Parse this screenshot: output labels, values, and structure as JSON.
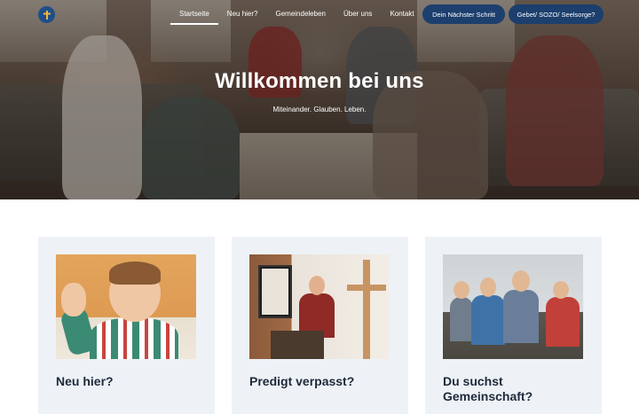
{
  "nav": {
    "items": [
      {
        "label": "Startseite",
        "active": true
      },
      {
        "label": "Neu hier?",
        "active": false
      },
      {
        "label": "Gemeindeleben",
        "active": false
      },
      {
        "label": "Über uns",
        "active": false
      },
      {
        "label": "Kontakt",
        "active": false
      }
    ],
    "cta_primary": "Dein Nächster Schritt",
    "cta_secondary": "Gebet/ SOZO/ Seelsorge?"
  },
  "hero": {
    "title": "Willkommen bei uns",
    "subtitle": "Miteinander. Glauben. Leben."
  },
  "cards": [
    {
      "title": "Neu hier?"
    },
    {
      "title": "Predigt verpasst?"
    },
    {
      "title": "Du suchst Gemeinschaft?"
    }
  ],
  "colors": {
    "accent": "#1c3f6e",
    "card_bg": "#eef2f7",
    "heading": "#1e2a3a"
  },
  "icons": {
    "logo": "church-logo-icon"
  }
}
